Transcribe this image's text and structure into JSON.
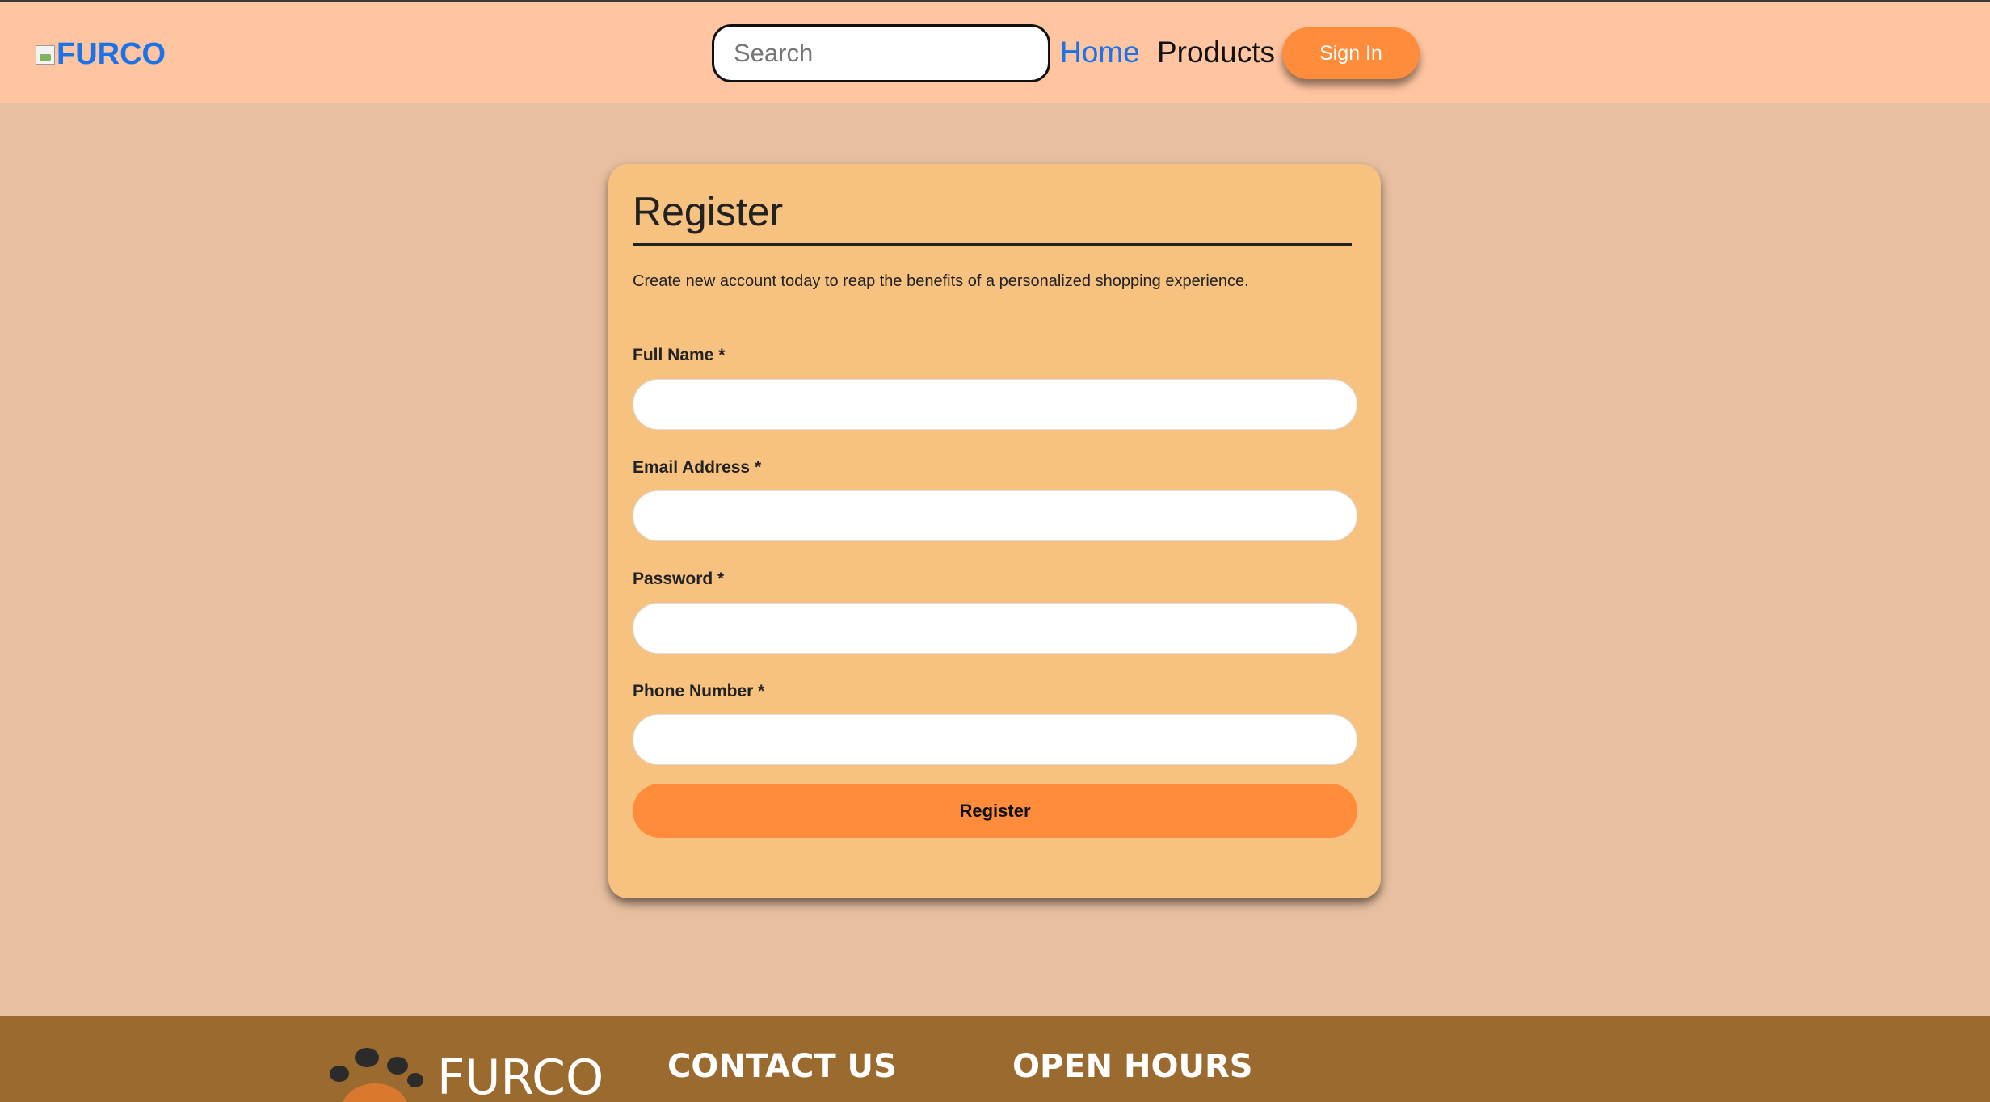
{
  "header": {
    "logo_text": "FURCO",
    "search_placeholder": "Search",
    "nav": {
      "home": "Home",
      "products": "Products"
    },
    "signin_label": "Sign In"
  },
  "form": {
    "title": "Register",
    "description": "Create new account today to reap the benefits of a personalized shopping experience.",
    "fields": [
      {
        "label": "Full Name *",
        "value": ""
      },
      {
        "label": "Email Address *",
        "value": ""
      },
      {
        "label": "Password *",
        "value": ""
      },
      {
        "label": "Phone Number *",
        "value": ""
      }
    ],
    "submit_label": "Register"
  },
  "footer": {
    "brand": "FURCO",
    "contact_heading": "CONTACT US",
    "hours_heading": "OPEN HOURS"
  },
  "colors": {
    "header_bg": "#ffc5a0",
    "page_bg": "#e8c0a1",
    "card_bg": "#f7c17f",
    "accent": "#ff8c3a",
    "link": "#1a73e8",
    "footer_bg": "#9b6a2e"
  },
  "icons": {
    "logo": "broken-image-icon",
    "footer_logo": "paw-icon"
  }
}
